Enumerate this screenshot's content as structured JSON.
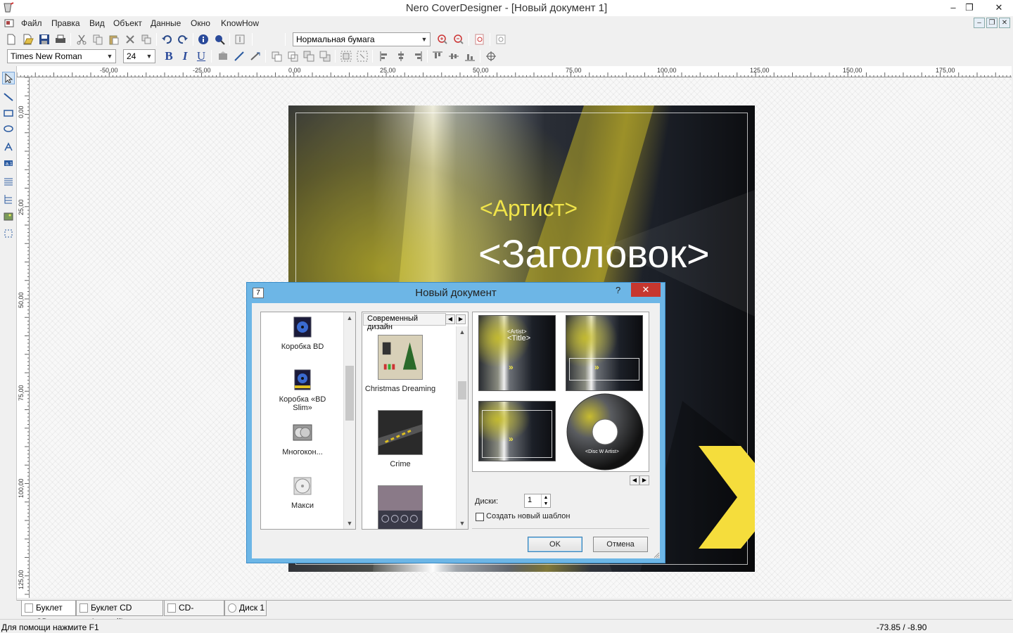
{
  "window": {
    "title": "Nero CoverDesigner - [Новый документ 1]",
    "minimize": "–",
    "restore": "❐",
    "close": "✕"
  },
  "menu": {
    "items": [
      "Файл",
      "Правка",
      "Вид",
      "Объект",
      "Данные",
      "Окно",
      "KnowHow"
    ],
    "mdi_minimize": "–",
    "mdi_restore": "❐",
    "mdi_close": "✕"
  },
  "toolbar": {
    "paper_combo": "Нормальная бумага",
    "font_combo": "Times New Roman",
    "size_combo": "24",
    "bold": "B",
    "italic": "I",
    "underline": "U"
  },
  "ruler": {
    "h_labels": [
      "-50,00",
      "-25,00",
      "0,00",
      "25,00",
      "50,00",
      "75,00",
      "100,00",
      "125,00",
      "150,00",
      "175,00"
    ],
    "v_labels": [
      "0,00",
      "25,00",
      "50,00",
      "75,00",
      "100,00",
      "125,00"
    ]
  },
  "cover": {
    "artist": "<Артист>",
    "heading": "<Заголовок>"
  },
  "tabs": [
    {
      "label": "Буклет CD"
    },
    {
      "label": "Буклет CD (задний)"
    },
    {
      "label": "CD-вкладка"
    },
    {
      "label": "Диск 1"
    }
  ],
  "status": {
    "help": "Для помощи нажмите F1",
    "coords": "-73.85 / -8.90"
  },
  "dialog": {
    "title": "Новый документ",
    "help": "?",
    "close": "✕",
    "box_types": [
      {
        "label": "Коробка BD"
      },
      {
        "label": "Коробка «BD Slim»"
      },
      {
        "label": "Многокон..."
      },
      {
        "label": "Макси"
      }
    ],
    "category": "Современный дизайн",
    "templates": [
      {
        "label": "Christmas Dreaming"
      },
      {
        "label": "Crime"
      },
      {
        "label": ""
      }
    ],
    "preview_texts": {
      "artist": "<Artist>",
      "title": "<Title>",
      "disc": "<Disc W Artist>"
    },
    "discs_label": "Диски:",
    "discs_value": "1",
    "new_template_label": "Создать новый шаблон",
    "ok": "OK",
    "cancel": "Отмена"
  },
  "colors": {
    "accent_yellow": "#f0e44a",
    "dialog_frame": "#6db6e6",
    "close_red": "#c7372f"
  }
}
